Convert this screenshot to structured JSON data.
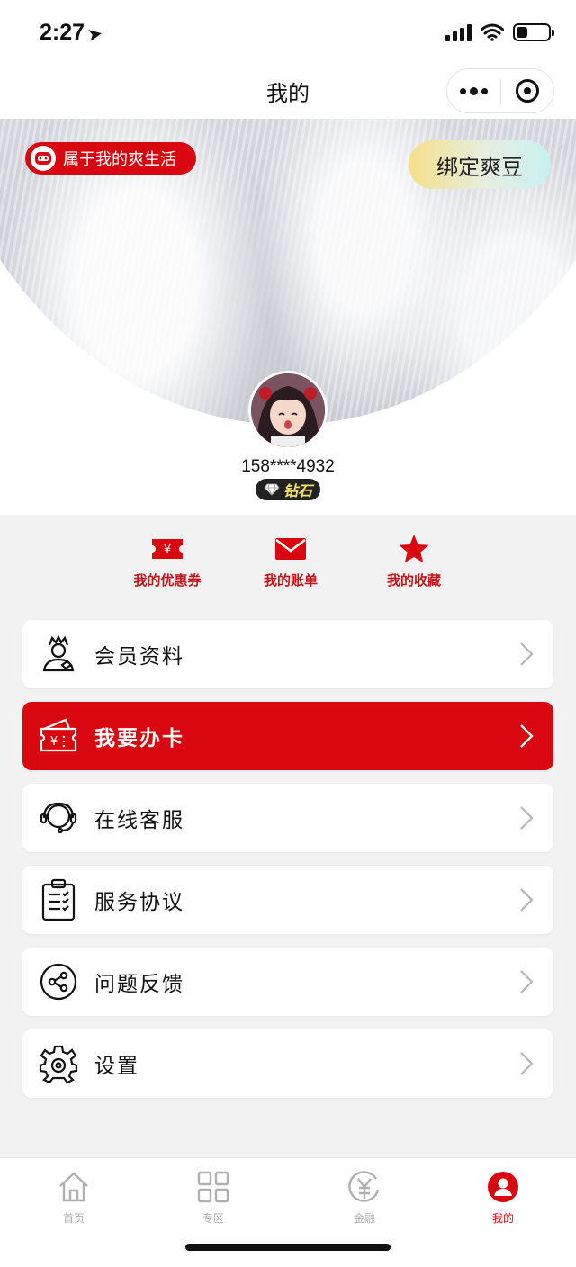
{
  "status_bar": {
    "time": "2:27",
    "battery_level": 0.35
  },
  "nav": {
    "title": "我的"
  },
  "header": {
    "tag_label": "属于我的爽生活",
    "bind_button": "绑定爽豆",
    "phone": "158****4932",
    "level": "钻石"
  },
  "quick_links": [
    {
      "label": "我的优惠券",
      "icon": "ticket-icon"
    },
    {
      "label": "我的账单",
      "icon": "envelope-icon"
    },
    {
      "label": "我的收藏",
      "icon": "star-icon"
    }
  ],
  "menu": [
    {
      "label": "会员资料",
      "icon": "member-profile-icon"
    },
    {
      "label": "我要办卡",
      "icon": "card-apply-icon"
    },
    {
      "label": "在线客服",
      "icon": "customer-service-icon"
    },
    {
      "label": "服务协议",
      "icon": "agreement-clipboard-icon"
    },
    {
      "label": "问题反馈",
      "icon": "feedback-share-icon"
    },
    {
      "label": "设置",
      "icon": "settings-gear-icon"
    }
  ],
  "tabs": [
    {
      "label": "首页",
      "icon": "home-icon"
    },
    {
      "label": "专区",
      "icon": "grid-icon"
    },
    {
      "label": "金融",
      "icon": "yuan-icon"
    },
    {
      "label": "我的",
      "icon": "profile-icon",
      "active": true
    }
  ],
  "colors": {
    "brand_red": "#d9070f",
    "text": "#111111",
    "inactive": "#b0b0b0"
  }
}
